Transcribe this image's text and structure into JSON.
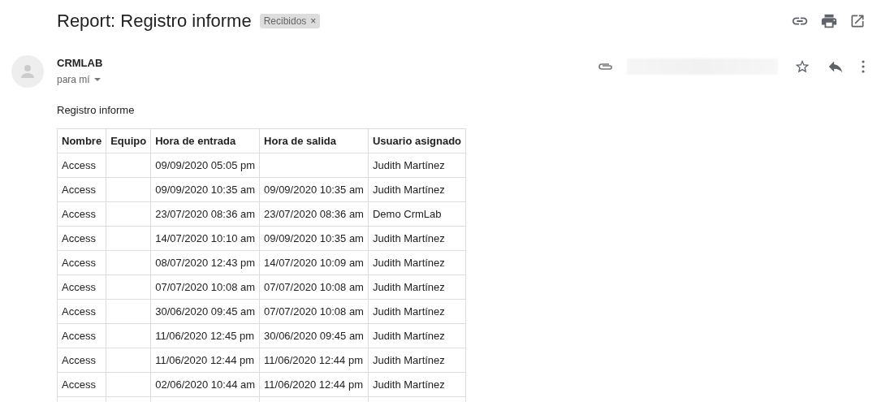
{
  "subject": {
    "title": "Report: Registro informe",
    "label": "Recibidos",
    "label_close": "×"
  },
  "sender": {
    "name": "CRMLAB",
    "recipient": "para mí"
  },
  "body": {
    "intro": "Registro informe"
  },
  "table": {
    "columns": [
      "Nombre",
      "Equipo",
      "Hora de entrada",
      "Hora de salida",
      "Usuario asignado"
    ],
    "rows": [
      [
        "Access",
        "",
        "09/09/2020 05:05 pm",
        "",
        "Judith Martínez"
      ],
      [
        "Access",
        "",
        "09/09/2020 10:35 am",
        "09/09/2020 10:35 am",
        "Judith Martínez"
      ],
      [
        "Access",
        "",
        "23/07/2020 08:36 am",
        "23/07/2020 08:36 am",
        "Demo CrmLab"
      ],
      [
        "Access",
        "",
        "14/07/2020 10:10 am",
        "09/09/2020 10:35 am",
        "Judith Martínez"
      ],
      [
        "Access",
        "",
        "08/07/2020 12:43 pm",
        "14/07/2020 10:09 am",
        "Judith Martínez"
      ],
      [
        "Access",
        "",
        "07/07/2020 10:08 am",
        "07/07/2020 10:08 am",
        "Judith Martínez"
      ],
      [
        "Access",
        "",
        "30/06/2020 09:45 am",
        "07/07/2020 10:08 am",
        "Judith Martínez"
      ],
      [
        "Access",
        "",
        "11/06/2020 12:45 pm",
        "30/06/2020 09:45 am",
        "Judith Martínez"
      ],
      [
        "Access",
        "",
        "11/06/2020 12:44 pm",
        "11/06/2020 12:44 pm",
        "Judith Martínez"
      ],
      [
        "Access",
        "",
        "02/06/2020 10:44 am",
        "11/06/2020 12:44 pm",
        "Judith Martínez"
      ]
    ]
  }
}
